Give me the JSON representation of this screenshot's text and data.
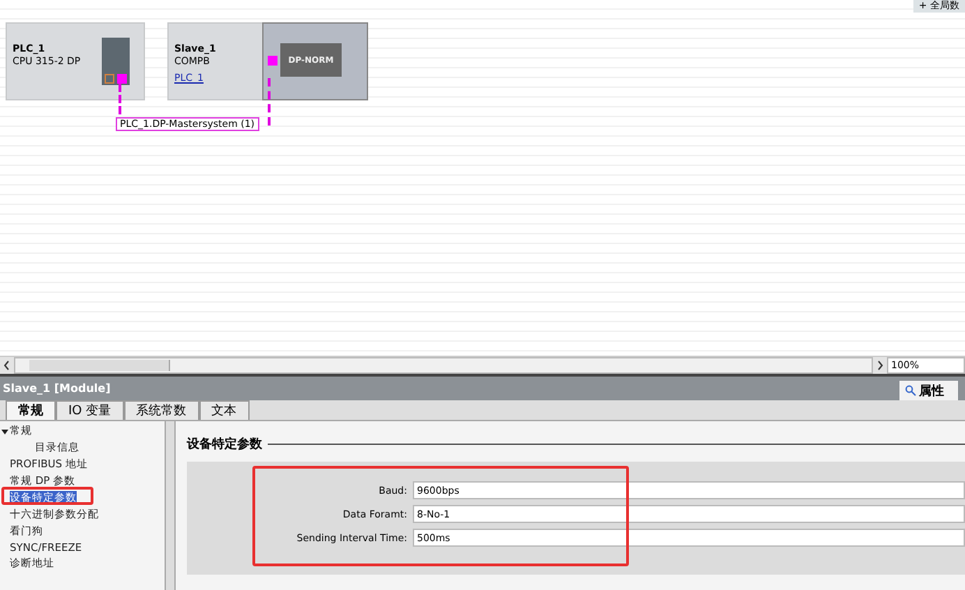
{
  "canvas": {
    "corner_button": "+ 全局数",
    "devices": [
      {
        "kind": "plc",
        "name": "PLC_1",
        "type": "CPU 315-2 DP"
      },
      {
        "kind": "slave",
        "name": "Slave_1",
        "type": "COMPB",
        "link": "PLC_1",
        "module": "DP-NORM"
      }
    ],
    "network_label": "PLC_1.DP-Mastersystem (1)",
    "zoom": "100%"
  },
  "inspector": {
    "title": "Slave_1 [Module]",
    "side_tab": "属性",
    "tabs": [
      {
        "label": "常规",
        "selected": true
      },
      {
        "label": "IO 变量",
        "selected": false
      },
      {
        "label": "系统常数",
        "selected": false
      },
      {
        "label": "文本",
        "selected": false
      }
    ],
    "nav": [
      {
        "label": "常规",
        "selected": false,
        "children": [
          {
            "label": "目录信息",
            "selected": false
          }
        ]
      },
      {
        "label": "PROFIBUS 地址",
        "selected": false
      },
      {
        "label": "常规 DP 参数",
        "selected": false
      },
      {
        "label": "设备特定参数",
        "selected": true
      },
      {
        "label": "十六进制参数分配",
        "selected": false
      },
      {
        "label": "看门狗",
        "selected": false
      },
      {
        "label": "SYNC/FREEZE",
        "selected": false
      },
      {
        "label": "诊断地址",
        "selected": false
      }
    ],
    "section_title": "设备特定参数",
    "fields": [
      {
        "label": "Baud:",
        "value": "9600bps"
      },
      {
        "label": "Data Foramt:",
        "value": "8-No-1"
      },
      {
        "label": "Sending Interval Time:",
        "value": "500ms"
      }
    ]
  }
}
